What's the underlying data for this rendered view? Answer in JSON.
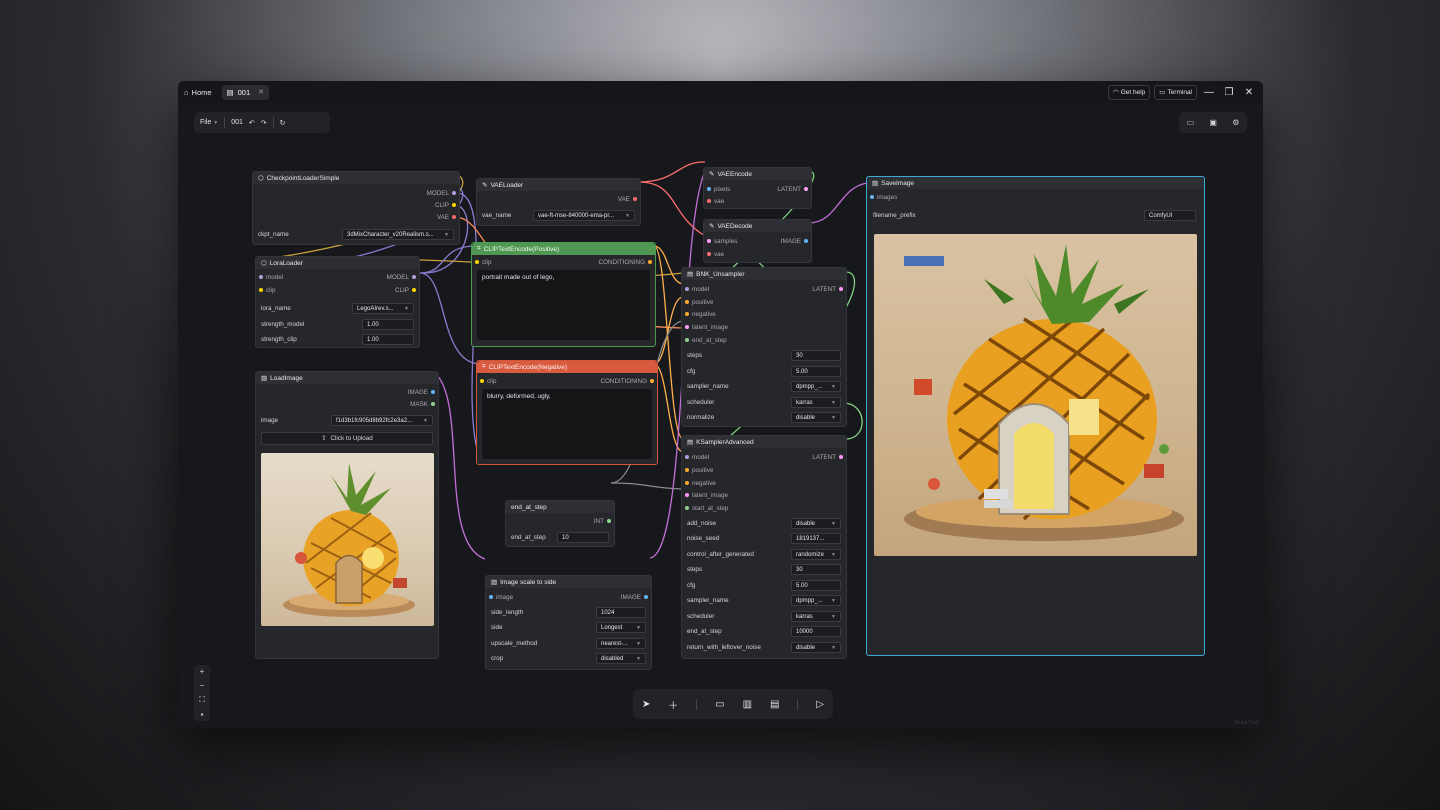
{
  "titlebar": {
    "home_label": "Home",
    "tab_label": "001",
    "get_help_label": "Get help",
    "terminal_label": "Terminal"
  },
  "toolbar": {
    "file_label": "File",
    "workflow_name": "001"
  },
  "nodes": {
    "checkpoint": {
      "title": "CheckpointLoaderSimple",
      "outputs": [
        "MODEL",
        "CLIP",
        "VAE"
      ],
      "ckpt_label": "ckpt_name",
      "ckpt_value": "3dMixCharacter_v20Realism.s..."
    },
    "vae_loader": {
      "title": "VAELoader",
      "output": "VAE",
      "vae_label": "vae_name",
      "vae_value": "vae-ft-mse-840000-ema-pr..."
    },
    "lora": {
      "title": "LoraLoader",
      "inputs": [
        "model",
        "clip"
      ],
      "outputs": [
        "MODEL",
        "CLIP"
      ],
      "lora_label": "lora_name",
      "lora_value": "LegoAIrev.s...",
      "strength_model_label": "strength_model",
      "strength_model_value": "1.00",
      "strength_clip_label": "strength_clip",
      "strength_clip_value": "1.00"
    },
    "clip_pos": {
      "title": "CLIPTextEncode(Positive)",
      "input": "clip",
      "output": "CONDITIONING",
      "text": "portrait made out of lego,"
    },
    "clip_neg": {
      "title": "CLIPTextEncode(Negative)",
      "input": "clip",
      "output": "CONDITIONING",
      "text": "blurry, deformed, ugly,"
    },
    "load_image": {
      "title": "LoadImage",
      "outputs": [
        "IMAGE",
        "MASK"
      ],
      "image_label": "image",
      "image_value": "f1d3b1fc905d8b92fc2e3a2...",
      "upload_label": "Click to Upload"
    },
    "vae_encode": {
      "title": "VAEEncode",
      "inputs": [
        "pixels",
        "vae"
      ],
      "output": "LATENT"
    },
    "vae_decode": {
      "title": "VAEDecode",
      "inputs": [
        "samples",
        "vae"
      ],
      "output": "IMAGE"
    },
    "unsampler": {
      "title": "BNK_Unsampler",
      "inputs": [
        "model",
        "positive",
        "negative",
        "latent_image",
        "end_at_step"
      ],
      "output": "LATENT",
      "widgets": [
        {
          "label": "steps",
          "value": "30",
          "dropdown": false
        },
        {
          "label": "cfg",
          "value": "5.00",
          "dropdown": false
        },
        {
          "label": "sampler_name",
          "value": "dpmpp_...",
          "dropdown": true
        },
        {
          "label": "scheduler",
          "value": "karras",
          "dropdown": true
        },
        {
          "label": "normalize",
          "value": "disable",
          "dropdown": true
        }
      ]
    },
    "ksampler": {
      "title": "KSamplerAdvanced",
      "inputs": [
        "model",
        "positive",
        "negative",
        "latent_image",
        "start_at_step"
      ],
      "output": "LATENT",
      "widgets": [
        {
          "label": "add_noise",
          "value": "disable",
          "dropdown": true
        },
        {
          "label": "noise_seed",
          "value": "1819137...",
          "dropdown": false
        },
        {
          "label": "control_after_generated",
          "value": "randomize",
          "dropdown": true
        },
        {
          "label": "steps",
          "value": "30",
          "dropdown": false
        },
        {
          "label": "cfg",
          "value": "5.00",
          "dropdown": false
        },
        {
          "label": "sampler_name",
          "value": "dpmpp_...",
          "dropdown": true
        },
        {
          "label": "scheduler",
          "value": "karras",
          "dropdown": true
        },
        {
          "label": "end_at_step",
          "value": "10000",
          "dropdown": false
        },
        {
          "label": "return_with_leftover_noise",
          "value": "disable",
          "dropdown": true
        }
      ]
    },
    "end_at_step": {
      "title": "end_at_step",
      "output": "INT",
      "label": "end_at_step",
      "value": "10"
    },
    "image_scale": {
      "title": "Image scale to side",
      "input": "image",
      "output": "IMAGE",
      "widgets": [
        {
          "label": "side_length",
          "value": "1024",
          "dropdown": false
        },
        {
          "label": "side",
          "value": "Longest",
          "dropdown": true
        },
        {
          "label": "upscale_method",
          "value": "nearest-...",
          "dropdown": true
        },
        {
          "label": "crop",
          "value": "disabled",
          "dropdown": true
        }
      ]
    },
    "save_image": {
      "title": "SaveImage",
      "input": "images",
      "prefix_label": "filename_prefix",
      "prefix_value": "ComfyUI"
    }
  },
  "colors": {
    "model": "#b39ddb",
    "clip": "#ffd500",
    "vae": "#ff6e6e",
    "conditioning": "#ffa931",
    "latent": "#ff9cf9",
    "image": "#64b5f6",
    "int": "#8fd48f",
    "positive_node": "#4f9752",
    "negative_node": "#d85a3f",
    "selected_border": "#3aaed2"
  },
  "watermark": "Rskdi Tech"
}
